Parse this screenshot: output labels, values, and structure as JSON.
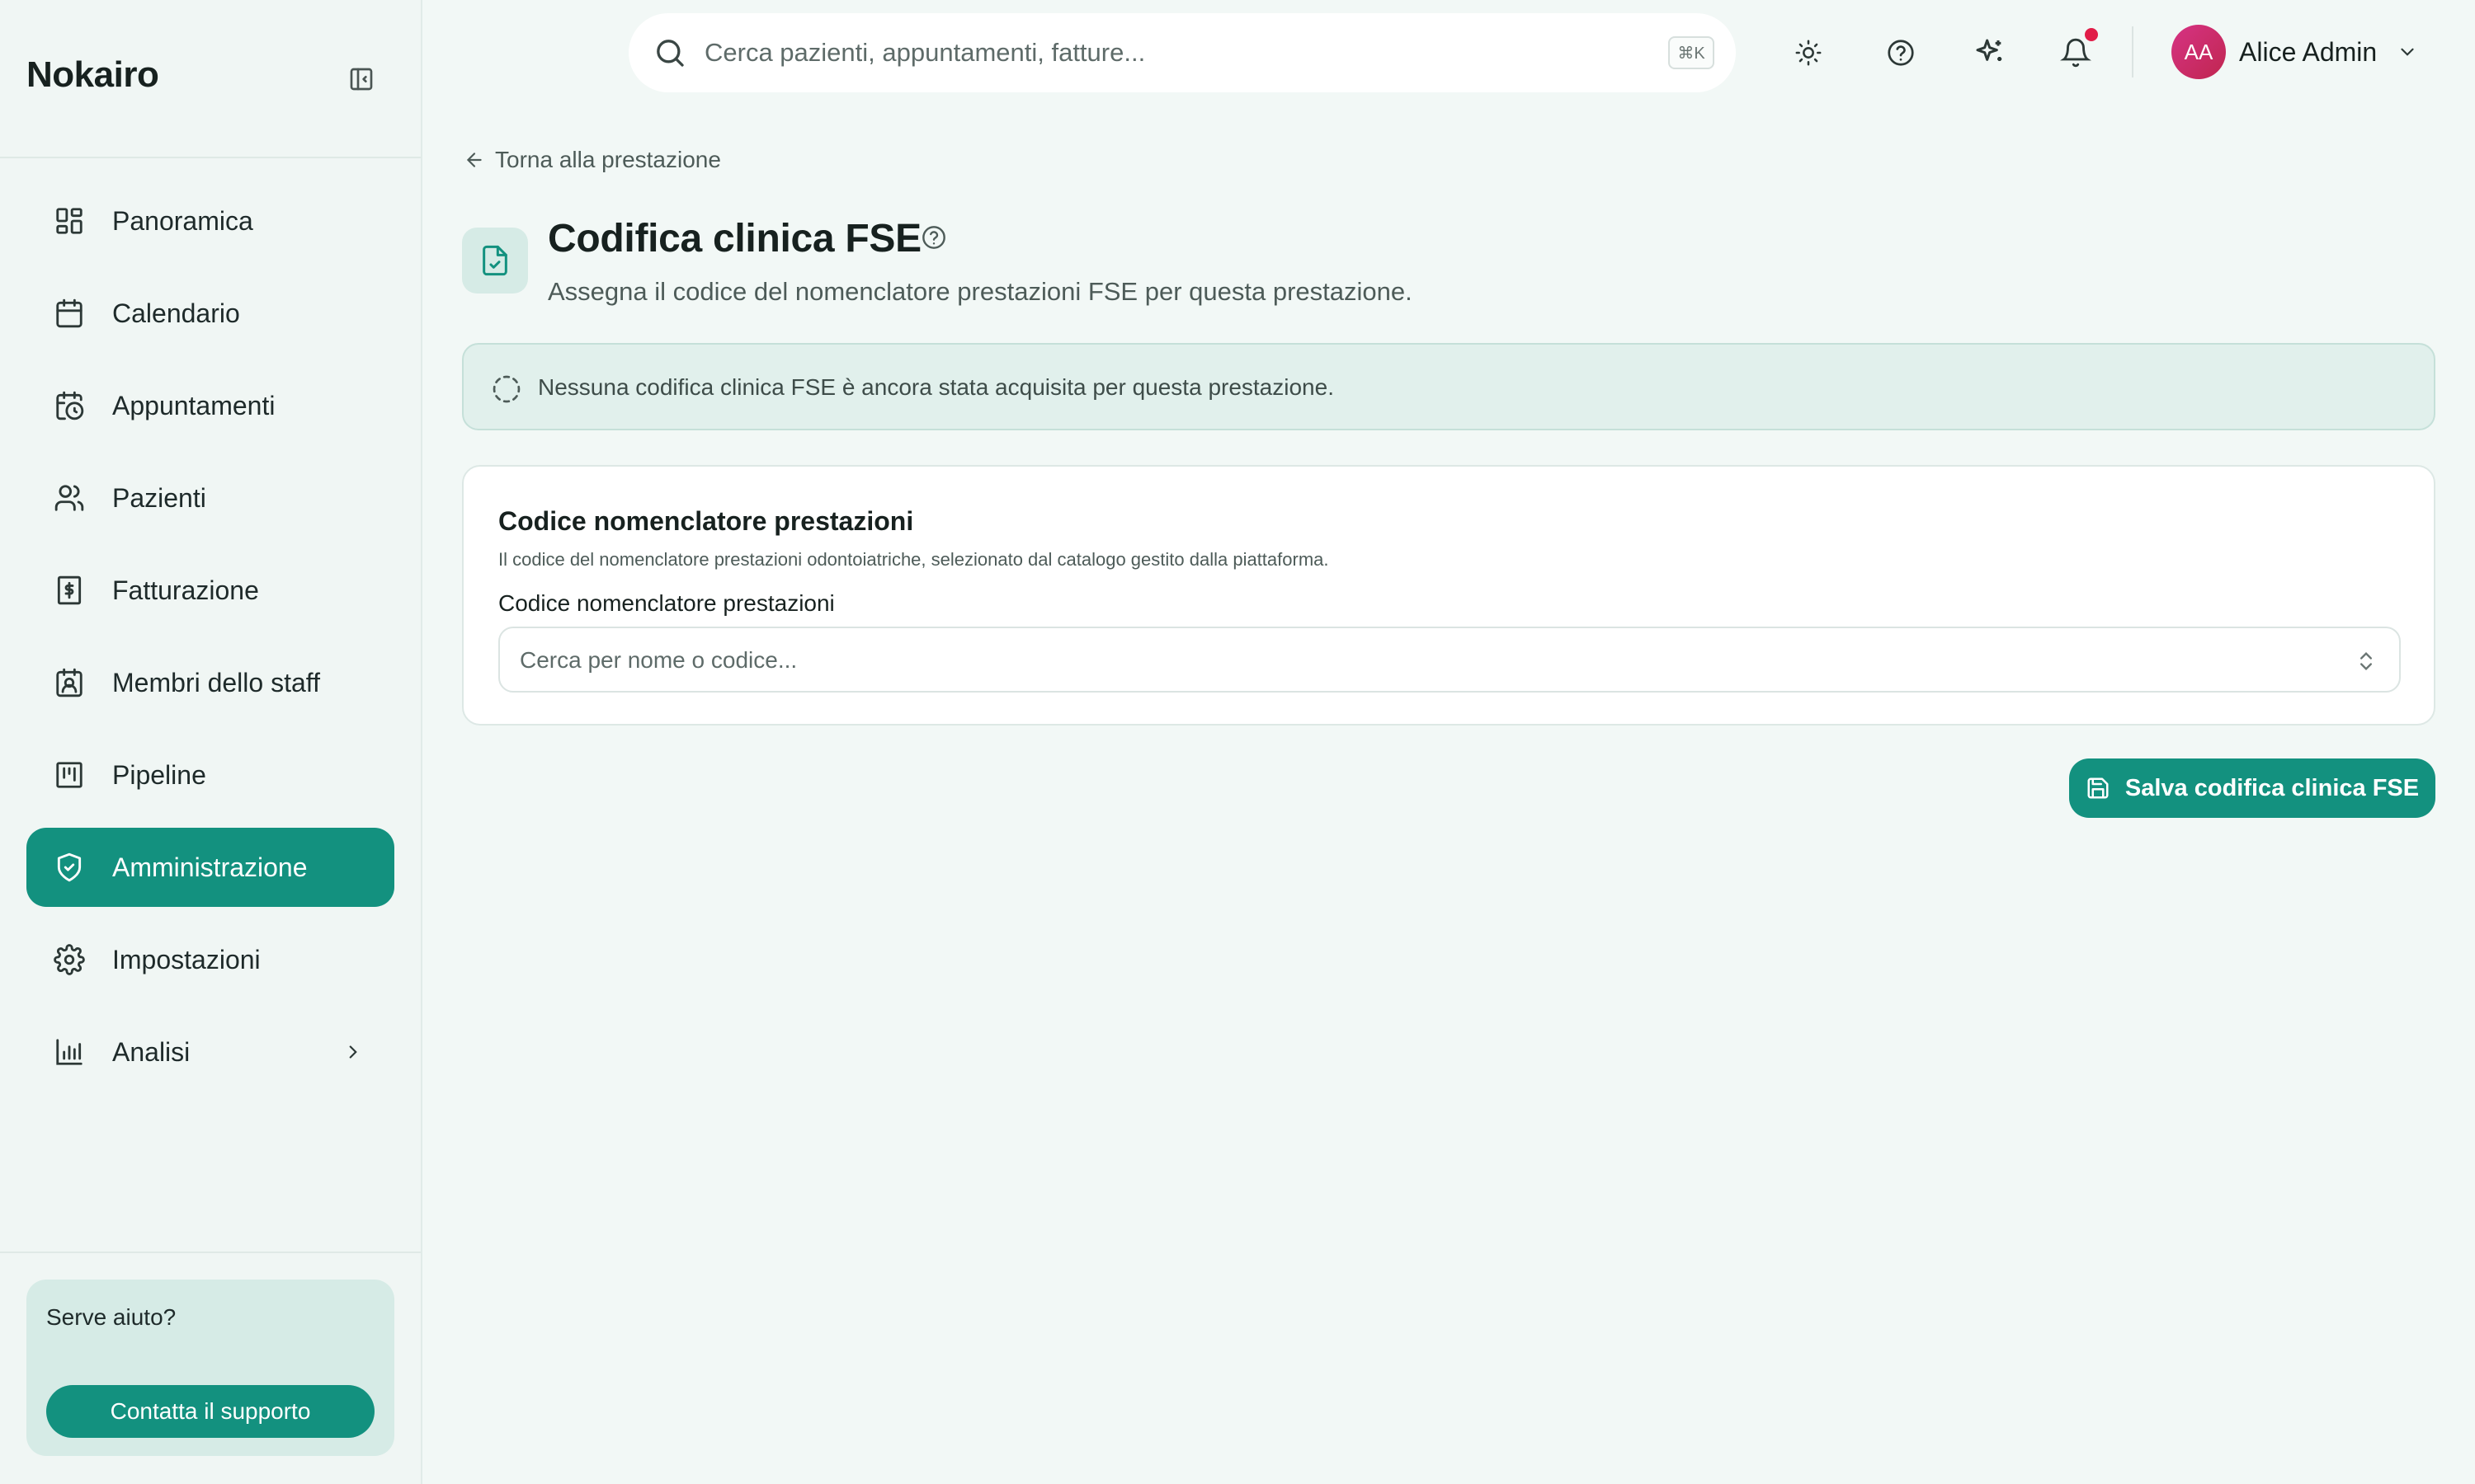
{
  "sidebar": {
    "brand": "Nokairo",
    "items": [
      {
        "label": "Panoramica",
        "icon": "dashboard-icon"
      },
      {
        "label": "Calendario",
        "icon": "calendar-icon"
      },
      {
        "label": "Appuntamenti",
        "icon": "calendar-clock-icon"
      },
      {
        "label": "Pazienti",
        "icon": "users-icon"
      },
      {
        "label": "Fatturazione",
        "icon": "receipt-icon"
      },
      {
        "label": "Membri dello staff",
        "icon": "badge-icon"
      },
      {
        "label": "Pipeline",
        "icon": "kanban-icon"
      },
      {
        "label": "Amministrazione",
        "icon": "shield-check-icon",
        "active": true
      },
      {
        "label": "Impostazioni",
        "icon": "gear-icon"
      },
      {
        "label": "Analisi",
        "icon": "bar-chart-icon",
        "expandable": true
      }
    ],
    "help": {
      "title": "Serve aiuto?",
      "button": "Contatta il supporto"
    }
  },
  "topbar": {
    "search_placeholder": "Cerca pazienti, appuntamenti, fatture...",
    "shortcut": "⌘K",
    "user": {
      "initials": "AA",
      "name": "Alice Admin"
    }
  },
  "main": {
    "back_label": "Torna alla prestazione",
    "title": "Codifica clinica FSE",
    "subtitle": "Assegna il codice del nomenclatore prestazioni FSE per questa prestazione.",
    "notice": "Nessuna codifica clinica FSE è ancora stata acquisita per questa prestazione.",
    "card": {
      "title": "Codice nomenclatore prestazioni",
      "description": "Il codice del nomenclatore prestazioni odontoiatriche, selezionato dal catalogo gestito dalla piattaforma.",
      "field_label": "Codice nomenclatore prestazioni",
      "field_placeholder": "Cerca per nome o codice..."
    },
    "save_label": "Salva codifica clinica FSE"
  },
  "colors": {
    "accent": "#13917f",
    "background": "#f2f8f6",
    "notification": "#e11d48"
  }
}
